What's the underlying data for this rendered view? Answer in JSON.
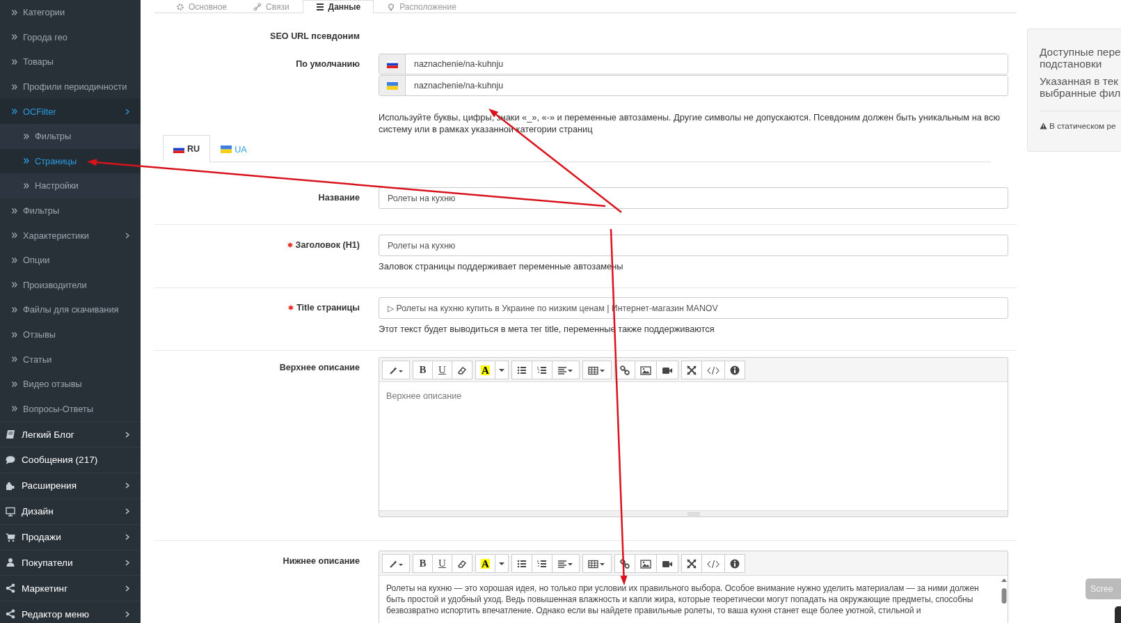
{
  "sidebar": {
    "catalog": [
      {
        "label": "Категории",
        "selected": false,
        "expandable": false
      },
      {
        "label": "Города гео",
        "selected": false,
        "expandable": false
      },
      {
        "label": "Товары",
        "selected": false,
        "expandable": false
      },
      {
        "label": "Профили периодичности",
        "selected": false,
        "expandable": false
      },
      {
        "label": "OCFilter",
        "selected": true,
        "expandable": true,
        "children": [
          {
            "label": "Фильтры",
            "selected": false
          },
          {
            "label": "Страницы",
            "selected": true
          },
          {
            "label": "Настройки",
            "selected": false
          }
        ]
      },
      {
        "label": "Фильтры",
        "selected": false,
        "expandable": false
      },
      {
        "label": "Характеристики",
        "selected": false,
        "expandable": true
      },
      {
        "label": "Опции",
        "selected": false,
        "expandable": false
      },
      {
        "label": "Производители",
        "selected": false,
        "expandable": false
      },
      {
        "label": "Файлы для скачивания",
        "selected": false,
        "expandable": false
      },
      {
        "label": "Отзывы",
        "selected": false,
        "expandable": false
      },
      {
        "label": "Статьи",
        "selected": false,
        "expandable": false
      },
      {
        "label": "Видео отзывы",
        "selected": false,
        "expandable": false
      },
      {
        "label": "Вопросы-Ответы",
        "selected": false,
        "expandable": false
      }
    ],
    "sections": [
      {
        "kind": "book",
        "label": "Легкий Блог",
        "expandable": true
      },
      {
        "kind": "comment",
        "label": "Сообщения (217)",
        "expandable": false
      },
      {
        "kind": "puzzle",
        "label": "Расширения",
        "expandable": true
      },
      {
        "kind": "monitor",
        "label": "Дизайн",
        "expandable": true
      },
      {
        "kind": "cart",
        "label": "Продажи",
        "expandable": true
      },
      {
        "kind": "user",
        "label": "Покупатели",
        "expandable": true
      },
      {
        "kind": "share",
        "label": "Маркетинг",
        "expandable": true
      },
      {
        "kind": "share",
        "label": "Редактор меню",
        "expandable": true
      }
    ]
  },
  "tabs": [
    {
      "kind": "gear",
      "label": "Основное",
      "selected": false
    },
    {
      "kind": "link",
      "label": "Связи",
      "selected": false
    },
    {
      "kind": "list",
      "label": "Данные",
      "selected": true
    },
    {
      "kind": "pin",
      "label": "Расположение",
      "selected": false
    }
  ],
  "seo": {
    "title": "SEO URL псевдоним",
    "label": "По умолчанию",
    "rows": [
      {
        "kind": "ru",
        "value": "naznachenie/na-kuhnju"
      },
      {
        "kind": "ua",
        "value": "naznachenie/na-kuhnju"
      }
    ],
    "help": "Используйте буквы, цифры, знаки «_», «-» и переменные автозамены. Другие символы не допускаются. Псевдоним должен быть уникальным на всю систему или в рамках указанной категории страниц"
  },
  "languages": [
    {
      "kind": "ru",
      "label": "RU",
      "selected": true
    },
    {
      "kind": "ua",
      "label": "UA",
      "selected": false
    }
  ],
  "fields": [
    {
      "kind": "input",
      "label": "Название",
      "required": false,
      "value": "Ролеты на кухню"
    },
    {
      "kind": "input",
      "label": "Заголовок (H1)",
      "required": true,
      "value": "Ролеты на кухню",
      "hint": "Заловок страницы поддерживает переменные автозамены"
    },
    {
      "kind": "input",
      "label": "Title страницы",
      "required": true,
      "value": "▷ Ролеты на кухню купить в Украине по низким ценам | Интернет-магазин MANOV",
      "hint": "Этот текст будет выводиться в мета тег title, переменные также поддерживаются"
    },
    {
      "kind": "editor",
      "label": "Верхнее описание",
      "required": false,
      "placeholder": "Верхнее описание",
      "toolbar": [
        [
          {
            "kind": "magic"
          }
        ],
        [
          {
            "kind": "bold",
            "label": "B"
          },
          {
            "kind": "underline",
            "label": "U"
          },
          {
            "kind": "eraser"
          }
        ],
        [
          {
            "kind": "highlight",
            "label": "A"
          },
          {
            "kind": "caret"
          }
        ],
        [
          {
            "kind": "ul"
          },
          {
            "kind": "ol"
          },
          {
            "kind": "align"
          }
        ],
        [
          {
            "kind": "table"
          }
        ],
        [
          {
            "kind": "link"
          },
          {
            "kind": "picture"
          },
          {
            "kind": "video"
          }
        ],
        [
          {
            "kind": "fullscreen"
          },
          {
            "kind": "code"
          },
          {
            "kind": "info"
          }
        ]
      ]
    },
    {
      "kind": "editor",
      "label": "Нижнее описание",
      "required": false,
      "value": "Ролеты на кухню — это хорошая идея, но только при условии их правильного выбора. Особое внимание нужно уделить материалам — за ними должен быть простой и удобный уход. Ведь повышенная влажность и капли жира, которые теоретически могут попадать на окружающие предметы, способны безвозвратно испортить впечатление. Однако если вы найдете правильные ролеты, то ваша кухня станет еще более уютной, стильной и",
      "toolbar": [
        [
          {
            "kind": "magic"
          }
        ],
        [
          {
            "kind": "bold",
            "label": "B"
          },
          {
            "kind": "underline",
            "label": "U"
          },
          {
            "kind": "eraser"
          }
        ],
        [
          {
            "kind": "highlight",
            "label": "A"
          },
          {
            "kind": "caret"
          }
        ],
        [
          {
            "kind": "ul"
          },
          {
            "kind": "ol"
          },
          {
            "kind": "align"
          }
        ],
        [
          {
            "kind": "table"
          }
        ],
        [
          {
            "kind": "link"
          },
          {
            "kind": "picture"
          },
          {
            "kind": "video"
          }
        ],
        [
          {
            "kind": "fullscreen"
          },
          {
            "kind": "code"
          },
          {
            "kind": "info"
          }
        ]
      ]
    }
  ],
  "panel": {
    "title_lines": [
      "Доступные пере",
      "подстановки"
    ],
    "text_lines": [
      "Указанная в тек",
      "выбранные фил"
    ],
    "warning": "В статическом ре"
  },
  "overlay_button": "Scree"
}
